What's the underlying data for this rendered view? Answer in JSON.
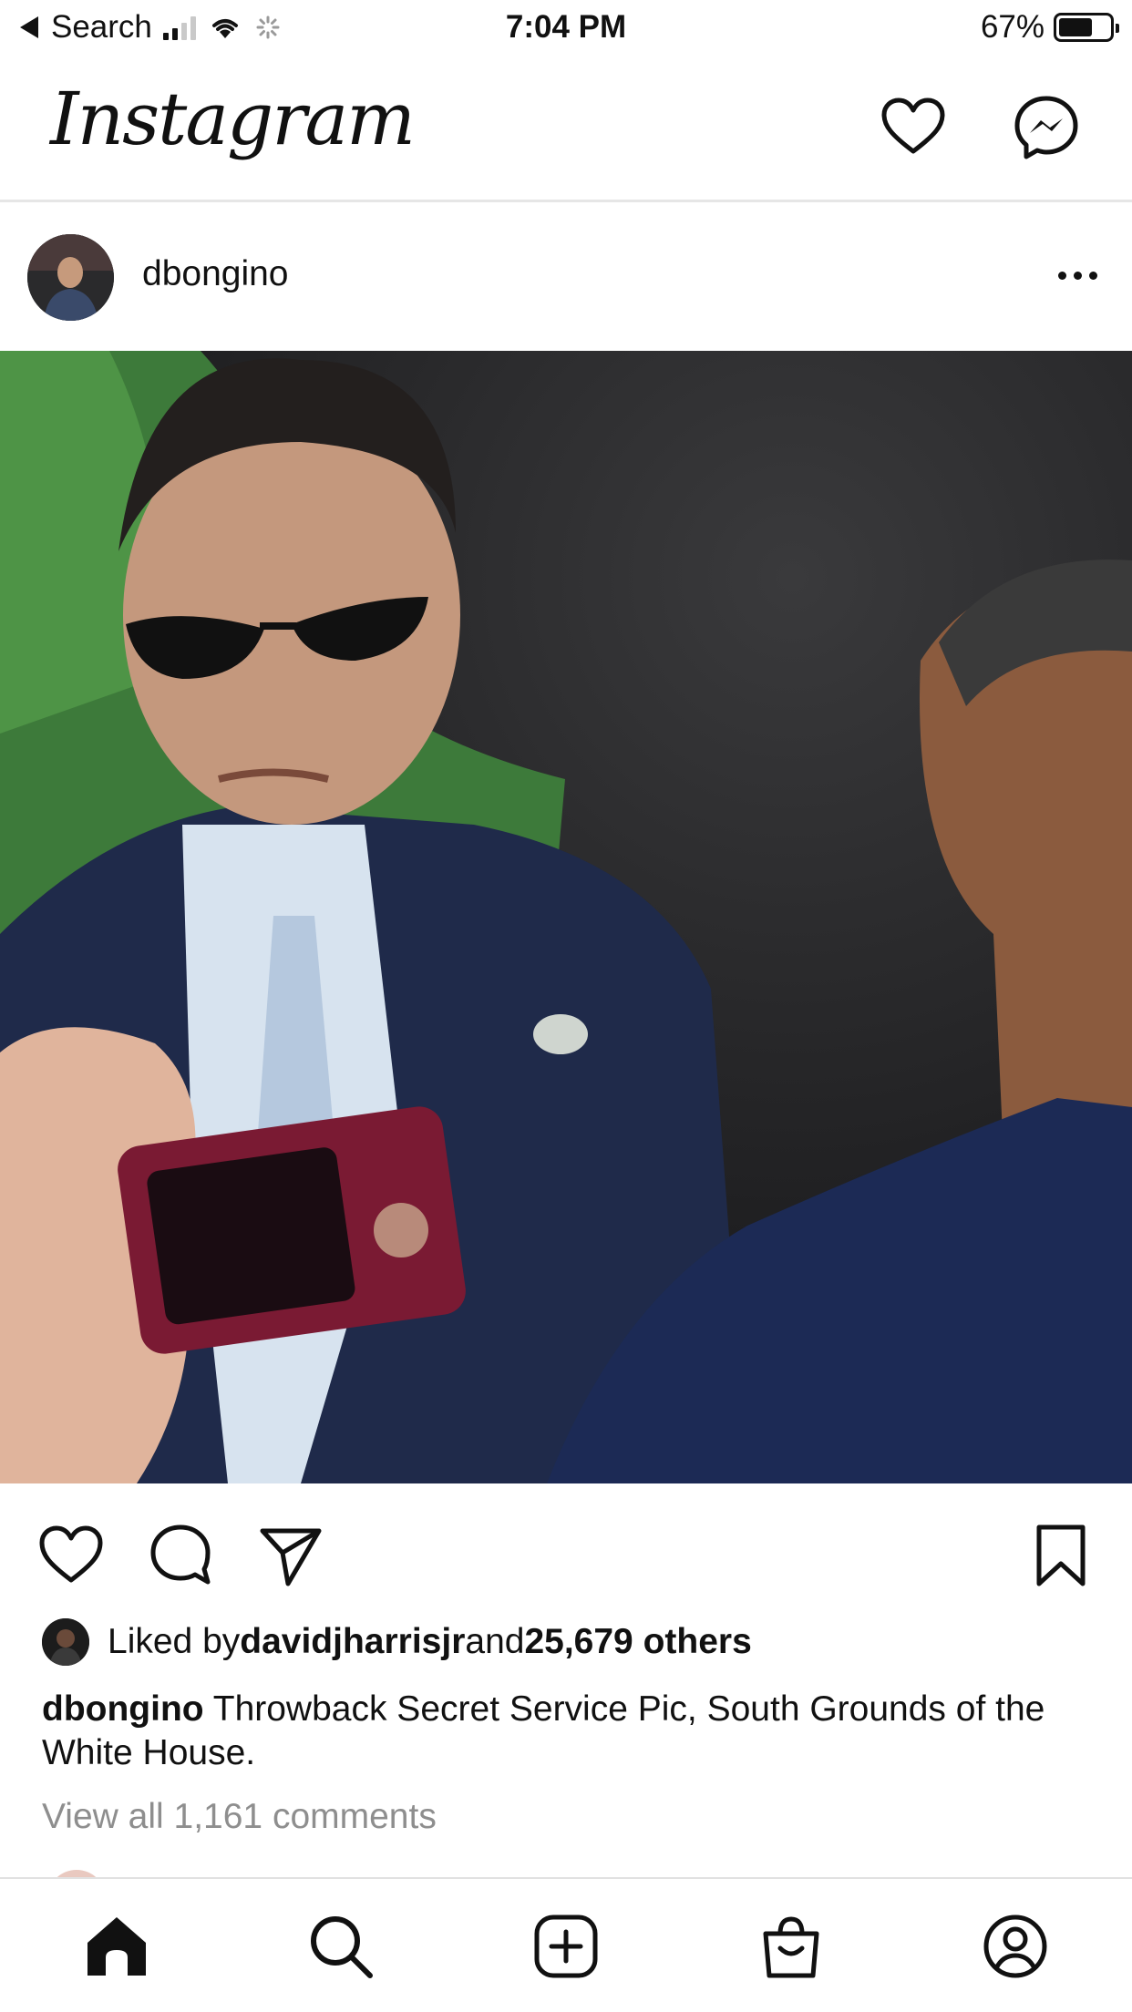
{
  "status_bar": {
    "back_label": "Search",
    "time": "7:04 PM",
    "battery_percent": "67%",
    "battery_level": 0.67,
    "icons": [
      "back-arrow-icon",
      "signal-icon",
      "wifi-icon",
      "activity-spinner-icon",
      "battery-icon"
    ]
  },
  "header": {
    "logo": "Instagram",
    "icons": [
      "heart-icon",
      "messenger-icon"
    ]
  },
  "post": {
    "username": "dbongino",
    "more_icon": "more-options-icon",
    "actions": [
      "heart-icon",
      "comment-icon",
      "share-icon",
      "bookmark-icon"
    ],
    "likes": {
      "prefix": "Liked by ",
      "liker": "davidjharrisjr",
      "middle": " and ",
      "count": "25,679 others"
    },
    "caption": {
      "username": "dbongino",
      "text": " Throwback Secret Service Pic, South Grounds of the White House."
    },
    "view_comments": "View all 1,161 comments"
  },
  "tab_bar": {
    "items": [
      "home-icon",
      "search-icon",
      "new-post-icon",
      "shop-icon",
      "profile-icon"
    ]
  },
  "colors": {
    "text": "#111111",
    "secondary_text": "#8e8e8e",
    "divider": "#e6e6e6"
  }
}
